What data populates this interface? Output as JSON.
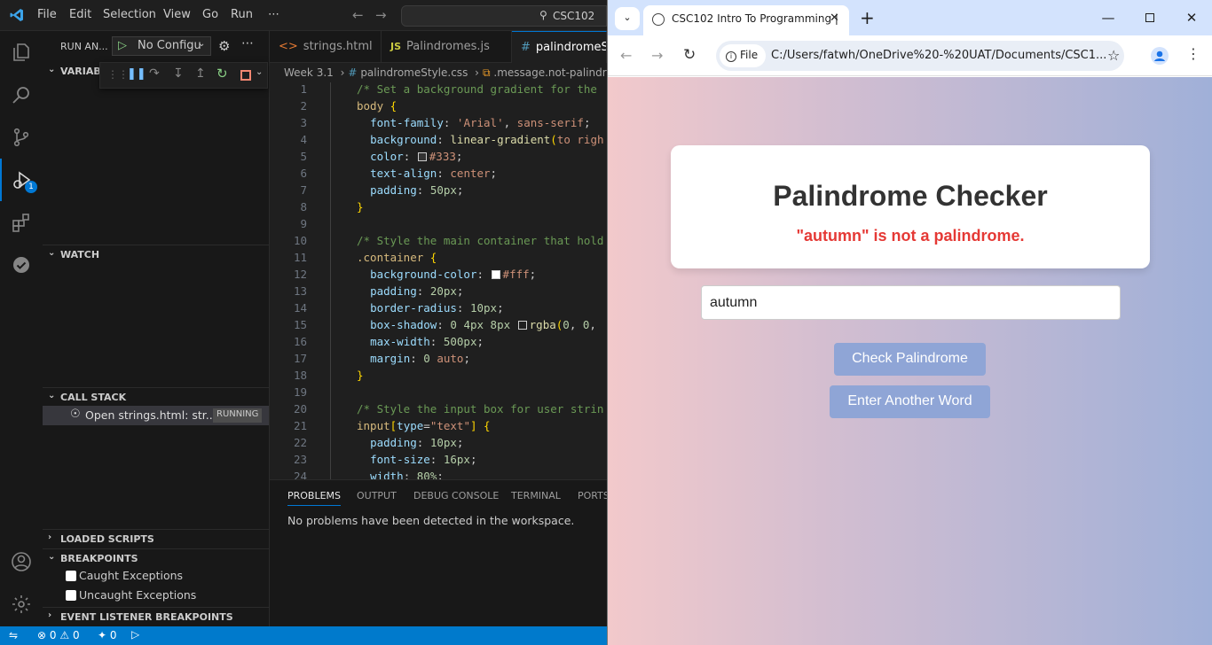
{
  "vscode": {
    "menu": [
      "File",
      "Edit",
      "Selection",
      "View",
      "Go",
      "Run",
      "⋯"
    ],
    "command_center": "CSC102",
    "sidebar": {
      "run_title": "RUN AN...",
      "config": "No Configu",
      "sections": {
        "variables": "VARIABLES",
        "watch": "WATCH",
        "call_stack": "CALL STACK",
        "loaded_scripts": "LOADED SCRIPTS",
        "breakpoints": "BREAKPOINTS",
        "event_listener": "EVENT LISTENER BREAKPOINTS"
      },
      "call_stack_item": "Open strings.html: str...",
      "call_stack_status": "RUNNING",
      "breakpoint_items": [
        "Caught Exceptions",
        "Uncaught Exceptions"
      ],
      "debug_badge": "1"
    },
    "tabs": [
      {
        "label": "strings.html",
        "icon": "<>"
      },
      {
        "label": "Palindromes.js",
        "icon": "JS"
      },
      {
        "label": "palindromeSt",
        "icon": "#"
      }
    ],
    "breadcrumb": [
      "Week 3.1",
      "palindromeStyle.css",
      ".message.not-palindro"
    ],
    "code_lines": [
      {
        "n": "1"
      },
      {
        "n": "2"
      },
      {
        "n": "3"
      },
      {
        "n": "4"
      },
      {
        "n": "5"
      },
      {
        "n": "6"
      },
      {
        "n": "7"
      },
      {
        "n": "8"
      },
      {
        "n": "9"
      },
      {
        "n": "10"
      },
      {
        "n": "11"
      },
      {
        "n": "12"
      },
      {
        "n": "13"
      },
      {
        "n": "14"
      },
      {
        "n": "15"
      },
      {
        "n": "16"
      },
      {
        "n": "17"
      },
      {
        "n": "18"
      },
      {
        "n": "19"
      },
      {
        "n": "20"
      },
      {
        "n": "21"
      },
      {
        "n": "22"
      },
      {
        "n": "23"
      },
      {
        "n": "24"
      }
    ],
    "panel": {
      "tabs": [
        "PROBLEMS",
        "OUTPUT",
        "DEBUG CONSOLE",
        "TERMINAL",
        "PORTS"
      ],
      "message": "No problems have been detected in the workspace."
    },
    "status": {
      "errors": "0",
      "warnings": "0",
      "ports": "0"
    }
  },
  "chrome": {
    "tab_title": "CSC102 Intro To Programming |",
    "address_scheme": "File",
    "address": "C:/Users/fatwh/OneDrive%20-%20UAT/Documents/CSC1...",
    "page": {
      "title": "Palindrome Checker",
      "message": "\"autumn\" is not a palindrome.",
      "input_value": "autumn",
      "check_button": "Check Palindrome",
      "another_button": "Enter Another Word"
    }
  },
  "colors": {
    "accent": "#007acc",
    "message_red": "#e53935",
    "button": "#8fa5d6"
  }
}
